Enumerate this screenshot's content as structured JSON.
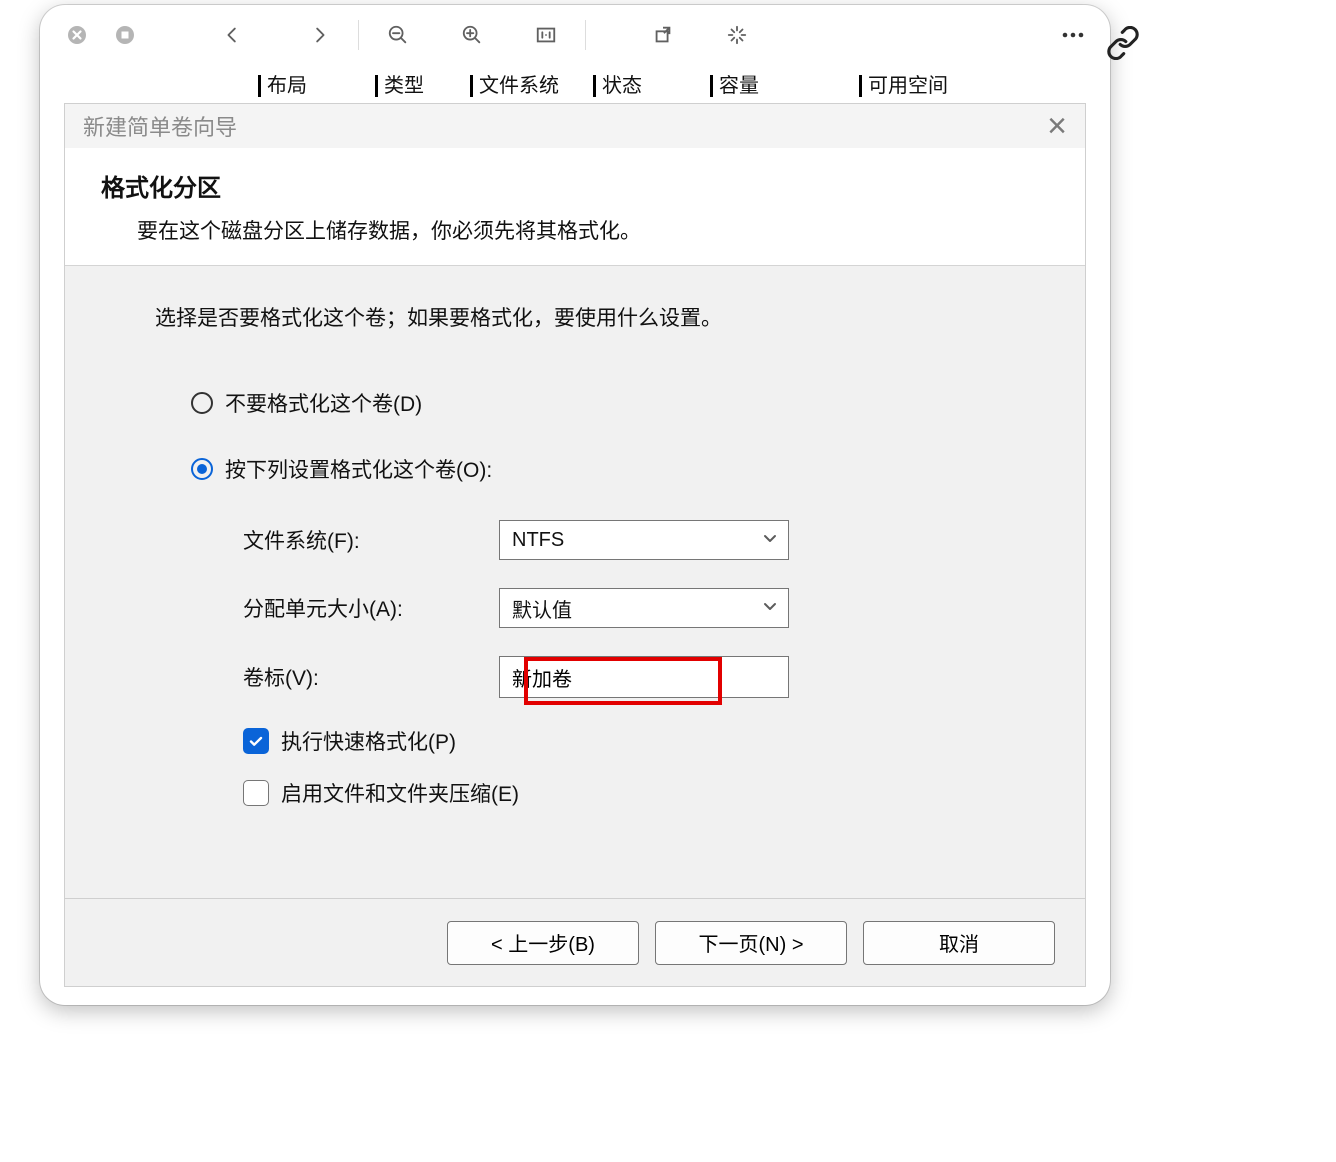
{
  "toolbar": {
    "icons": [
      "close-circle",
      "stop-circle",
      "arrow-left",
      "arrow-right",
      "zoom-out",
      "zoom-in",
      "fit-one-to-one",
      "open-external",
      "magic",
      "more"
    ]
  },
  "bg_headers": [
    "布局",
    "类型",
    "文件系统",
    "状态",
    "容量",
    "可用空间"
  ],
  "bg_header_pos": [
    218,
    358,
    476,
    620,
    760,
    928
  ],
  "dialog": {
    "title": "新建简单卷向导",
    "section_title": "格式化分区",
    "section_desc": "要在这个磁盘分区上储存数据，你必须先将其格式化。",
    "prompt": "选择是否要格式化这个卷；如果要格式化，要使用什么设置。",
    "radio_no_format": "不要格式化这个卷(D)",
    "radio_do_format": "按下列设置格式化这个卷(O):",
    "fs_label": "文件系统(F):",
    "fs_value": "NTFS",
    "alloc_label": "分配单元大小(A):",
    "alloc_value": "默认值",
    "vol_label": "卷标(V):",
    "vol_value": "新加卷",
    "quick_format": "执行快速格式化(P)",
    "compression": "启用文件和文件夹压缩(E)",
    "btn_back": "< 上一步(B)",
    "btn_next": "下一页(N) >",
    "btn_cancel": "取消"
  }
}
